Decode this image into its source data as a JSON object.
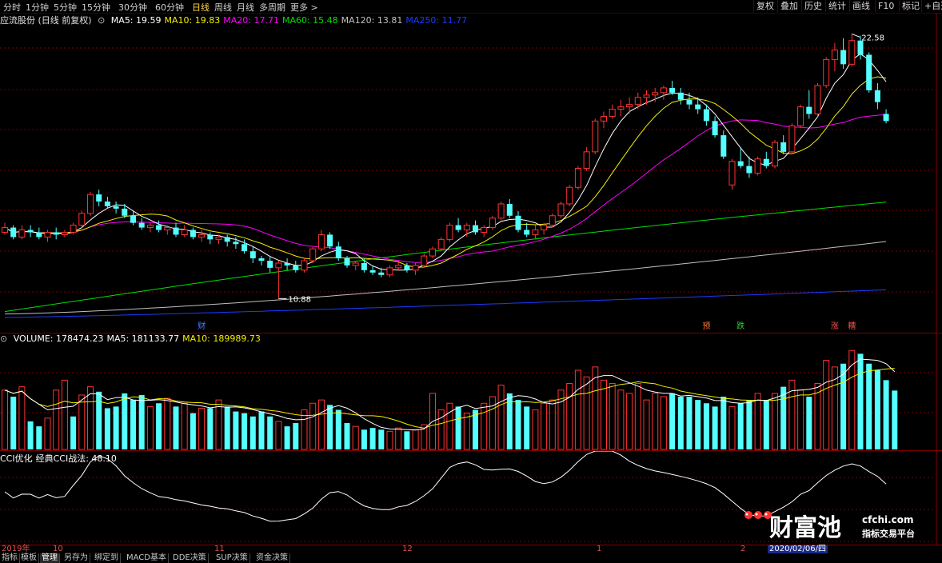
{
  "toolbar": {
    "periods": [
      "分时",
      "1分钟",
      "5分钟",
      "15分钟",
      "30分钟",
      "60分钟",
      "日线",
      "周线",
      "月线",
      "多周期",
      "更多 >"
    ],
    "active_period": "日线",
    "right_tabs": [
      "复权",
      "叠加",
      "历史",
      "统计",
      "画线",
      "F10",
      "标记",
      "+自选"
    ],
    "top_icons": [
      "settings-icon",
      "close-icon"
    ]
  },
  "main_legend": {
    "title": "应流股份 (日线 前复权)",
    "items": [
      {
        "label": "MA5: 19.59",
        "color": "#ffffff"
      },
      {
        "label": "MA10: 19.83",
        "color": "#f0f000"
      },
      {
        "label": "MA20: 17.71",
        "color": "#ff00ff"
      },
      {
        "label": "MA60: 15.48",
        "color": "#00e000"
      },
      {
        "label": "MA120: 13.81",
        "color": "#c0c0c0"
      },
      {
        "label": "MA250: 11.77",
        "color": "#1a3cff"
      }
    ],
    "high_marker": "22.58",
    "low_marker": "10.88",
    "event_tags": [
      {
        "text": "财",
        "color": "#4f7fff"
      },
      {
        "text": "预",
        "color": "#ff7a30"
      },
      {
        "text": "跌",
        "color": "#30d030"
      },
      {
        "text": "涨",
        "color": "#ff5050"
      },
      {
        "text": "糟",
        "color": "#ff5050"
      }
    ]
  },
  "volume_legend": {
    "items": [
      {
        "label": "VOLUME: 178474.23",
        "color": "#ffffff"
      },
      {
        "label": "MA5: 181133.77",
        "color": "#ffffff"
      },
      {
        "label": "MA10: 189989.73",
        "color": "#f0f000"
      }
    ]
  },
  "cci_legend": {
    "items": [
      {
        "label": "CCI优化",
        "color": "#ffffff"
      },
      {
        "label": "经典CCI战法: 48.10",
        "color": "#ffffff"
      }
    ]
  },
  "date_axis": {
    "labels": [
      "2019年",
      "10",
      "11",
      "12",
      "1",
      "2",
      "2020/02/06/四"
    ],
    "selected": "2020/02/06/四"
  },
  "bottom_tabs": [
    "指标",
    "模板",
    "管理",
    "另存为",
    "绑定到",
    "MACD基本",
    "DDE决策",
    "SUP决策",
    "资金决策"
  ],
  "active_bottom_tab": "管理",
  "logo": {
    "brand": "财富池",
    "domain": "cfchi.com",
    "tagline": "指标交易平台"
  },
  "colors": {
    "up": "#ff3232",
    "down": "#54ffff",
    "grid": "#7a0000"
  },
  "chart_data": [
    {
      "type": "candlestick",
      "title": "应流股份 (日线 前复权)",
      "price_range": [
        10.5,
        23.0
      ],
      "high": 22.58,
      "low": 10.88,
      "candles": [
        [
          14.2,
          14.6,
          14.1,
          14.4
        ],
        [
          14.4,
          14.5,
          13.9,
          14.0
        ],
        [
          14.0,
          14.5,
          13.9,
          14.3
        ],
        [
          14.3,
          14.5,
          14.0,
          14.2
        ],
        [
          14.2,
          14.4,
          13.9,
          14.0
        ],
        [
          14.0,
          14.3,
          13.8,
          14.2
        ],
        [
          14.2,
          14.4,
          13.9,
          14.1
        ],
        [
          14.1,
          14.3,
          14.0,
          14.2
        ],
        [
          14.2,
          14.6,
          14.1,
          14.5
        ],
        [
          14.5,
          15.1,
          14.4,
          15.0
        ],
        [
          15.0,
          15.9,
          14.9,
          15.8
        ],
        [
          15.8,
          16.0,
          15.3,
          15.5
        ],
        [
          15.5,
          15.7,
          15.2,
          15.3
        ],
        [
          15.3,
          15.5,
          15.0,
          15.2
        ],
        [
          15.2,
          15.4,
          14.8,
          14.9
        ],
        [
          14.9,
          15.1,
          14.5,
          14.6
        ],
        [
          14.6,
          14.8,
          14.3,
          14.4
        ],
        [
          14.4,
          14.6,
          14.2,
          14.5
        ],
        [
          14.5,
          14.7,
          14.2,
          14.3
        ],
        [
          14.3,
          14.5,
          14.1,
          14.4
        ],
        [
          14.4,
          14.6,
          14.0,
          14.1
        ],
        [
          14.1,
          14.5,
          14.0,
          14.3
        ],
        [
          14.3,
          14.4,
          13.9,
          14.0
        ],
        [
          14.0,
          14.3,
          13.8,
          14.1
        ],
        [
          14.1,
          14.2,
          13.7,
          13.9
        ],
        [
          13.9,
          14.1,
          13.7,
          14.0
        ],
        [
          14.0,
          14.1,
          13.6,
          13.8
        ],
        [
          13.8,
          14.0,
          13.5,
          13.7
        ],
        [
          13.7,
          13.9,
          13.3,
          13.4
        ],
        [
          13.4,
          13.6,
          12.9,
          13.1
        ],
        [
          13.1,
          13.2,
          12.8,
          13.0
        ],
        [
          13.0,
          13.2,
          12.5,
          12.7
        ],
        [
          12.7,
          13.0,
          11.4,
          12.9
        ],
        [
          12.9,
          13.1,
          12.6,
          12.8
        ],
        [
          12.8,
          13.0,
          12.5,
          12.6
        ],
        [
          12.6,
          13.1,
          12.5,
          13.0
        ],
        [
          13.0,
          13.6,
          12.9,
          13.5
        ],
        [
          13.5,
          14.3,
          13.4,
          14.1
        ],
        [
          14.1,
          14.2,
          13.5,
          13.6
        ],
        [
          13.6,
          13.8,
          13.0,
          13.1
        ],
        [
          13.1,
          13.2,
          12.7,
          12.8
        ],
        [
          12.8,
          13.0,
          12.6,
          12.9
        ],
        [
          12.9,
          13.1,
          12.5,
          12.6
        ],
        [
          12.6,
          12.8,
          12.4,
          12.5
        ],
        [
          12.5,
          12.7,
          12.3,
          12.4
        ],
        [
          12.4,
          12.8,
          12.3,
          12.7
        ],
        [
          12.7,
          13.0,
          12.6,
          12.8
        ],
        [
          12.8,
          12.9,
          12.5,
          12.6
        ],
        [
          12.6,
          12.9,
          12.4,
          12.8
        ],
        [
          12.8,
          13.3,
          12.7,
          13.2
        ],
        [
          13.2,
          13.6,
          13.1,
          13.5
        ],
        [
          13.5,
          14.0,
          13.4,
          13.9
        ],
        [
          13.9,
          14.6,
          13.8,
          14.5
        ],
        [
          14.5,
          14.8,
          14.2,
          14.3
        ],
        [
          14.3,
          14.6,
          14.0,
          14.5
        ],
        [
          14.5,
          14.7,
          14.1,
          14.2
        ],
        [
          14.2,
          14.5,
          14.0,
          14.4
        ],
        [
          14.4,
          14.9,
          14.3,
          14.8
        ],
        [
          14.8,
          15.5,
          14.7,
          15.4
        ],
        [
          15.4,
          15.6,
          14.8,
          14.9
        ],
        [
          14.9,
          15.1,
          14.2,
          14.3
        ],
        [
          14.3,
          14.6,
          14.0,
          14.1
        ],
        [
          14.1,
          14.5,
          13.9,
          14.3
        ],
        [
          14.3,
          14.6,
          14.1,
          14.5
        ],
        [
          14.5,
          15.0,
          14.4,
          14.9
        ],
        [
          14.9,
          15.5,
          14.8,
          15.4
        ],
        [
          15.4,
          16.2,
          15.3,
          16.1
        ],
        [
          16.1,
          17.0,
          16.0,
          16.9
        ],
        [
          16.9,
          17.8,
          16.8,
          17.6
        ],
        [
          17.6,
          19.0,
          17.5,
          18.9
        ],
        [
          18.9,
          19.3,
          18.6,
          19.1
        ],
        [
          19.1,
          19.6,
          19.0,
          19.4
        ],
        [
          19.4,
          19.8,
          19.1,
          19.5
        ],
        [
          19.5,
          19.9,
          19.2,
          19.6
        ],
        [
          19.6,
          20.1,
          19.4,
          19.9
        ],
        [
          19.9,
          20.2,
          19.6,
          20.0
        ],
        [
          20.0,
          20.3,
          19.7,
          20.1
        ],
        [
          20.1,
          20.4,
          19.8,
          20.3
        ],
        [
          20.3,
          20.6,
          20.0,
          20.1
        ],
        [
          20.1,
          20.3,
          19.6,
          19.8
        ],
        [
          19.8,
          20.1,
          19.4,
          19.6
        ],
        [
          19.6,
          19.9,
          19.2,
          19.4
        ],
        [
          19.4,
          19.6,
          18.7,
          18.9
        ],
        [
          18.9,
          19.1,
          18.2,
          18.3
        ],
        [
          18.3,
          18.5,
          17.3,
          17.4
        ],
        [
          16.2,
          17.3,
          16.0,
          17.2
        ],
        [
          17.2,
          17.8,
          16.9,
          17.0
        ],
        [
          17.0,
          17.4,
          16.5,
          16.7
        ],
        [
          16.7,
          17.4,
          16.6,
          17.3
        ],
        [
          17.3,
          17.6,
          16.9,
          17.0
        ],
        [
          17.0,
          18.1,
          16.9,
          18.0
        ],
        [
          18.0,
          18.3,
          17.5,
          17.6
        ],
        [
          17.6,
          18.8,
          17.5,
          18.7
        ],
        [
          18.7,
          19.6,
          18.6,
          19.5
        ],
        [
          19.5,
          20.2,
          19.0,
          19.2
        ],
        [
          19.2,
          20.5,
          19.1,
          20.4
        ],
        [
          20.4,
          21.6,
          20.3,
          21.5
        ],
        [
          21.5,
          22.2,
          21.0,
          21.9
        ],
        [
          21.9,
          22.4,
          21.1,
          21.3
        ],
        [
          21.3,
          22.58,
          21.2,
          22.3
        ],
        [
          22.3,
          22.5,
          21.5,
          21.7
        ],
        [
          21.7,
          21.8,
          20.1,
          20.2
        ],
        [
          20.2,
          20.5,
          19.4,
          19.7
        ],
        [
          19.2,
          19.4,
          18.8,
          18.9
        ]
      ]
    },
    {
      "type": "bar",
      "title": "VOLUME",
      "ylim": [
        0,
        320000
      ],
      "values": [
        180000,
        160000,
        190000,
        85000,
        70000,
        95000,
        180000,
        210000,
        100000,
        165000,
        190000,
        175000,
        125000,
        130000,
        170000,
        150000,
        165000,
        130000,
        140000,
        155000,
        130000,
        140000,
        110000,
        125000,
        125000,
        150000,
        130000,
        115000,
        110000,
        100000,
        115000,
        100000,
        85000,
        70000,
        80000,
        120000,
        140000,
        150000,
        135000,
        120000,
        80000,
        70000,
        60000,
        65000,
        60000,
        55000,
        65000,
        55000,
        60000,
        75000,
        170000,
        120000,
        140000,
        130000,
        110000,
        120000,
        140000,
        160000,
        195000,
        170000,
        150000,
        130000,
        120000,
        140000,
        150000,
        180000,
        200000,
        240000,
        220000,
        250000,
        210000,
        200000,
        180000,
        170000,
        200000,
        150000,
        170000,
        160000,
        170000,
        160000,
        160000,
        150000,
        140000,
        130000,
        160000,
        130000,
        140000,
        150000,
        170000,
        150000,
        170000,
        190000,
        210000,
        180000,
        160000,
        200000,
        270000,
        250000,
        260000,
        300000,
        290000,
        260000,
        240000,
        210000,
        178474
      ],
      "up": [
        1,
        0,
        1,
        0,
        0,
        1,
        1,
        1,
        0,
        1,
        1,
        0,
        0,
        0,
        0,
        0,
        0,
        1,
        0,
        1,
        0,
        1,
        0,
        1,
        0,
        1,
        0,
        0,
        0,
        0,
        0,
        0,
        1,
        0,
        0,
        1,
        1,
        1,
        0,
        0,
        0,
        1,
        0,
        0,
        0,
        1,
        1,
        0,
        1,
        1,
        1,
        1,
        1,
        0,
        1,
        0,
        1,
        1,
        1,
        0,
        0,
        0,
        1,
        1,
        1,
        1,
        1,
        1,
        1,
        1,
        1,
        1,
        1,
        1,
        1,
        1,
        1,
        1,
        0,
        0,
        0,
        0,
        0,
        0,
        0,
        1,
        0,
        0,
        1,
        0,
        1,
        0,
        1,
        1,
        0,
        1,
        1,
        1,
        0,
        1,
        0,
        0,
        0,
        0,
        0
      ],
      "ma5": 181133.77,
      "ma10": 189989.73
    },
    {
      "type": "line",
      "title": "CCI优化",
      "series": [
        {
          "name": "经典CCI战法",
          "last": 48.1
        }
      ]
    }
  ]
}
